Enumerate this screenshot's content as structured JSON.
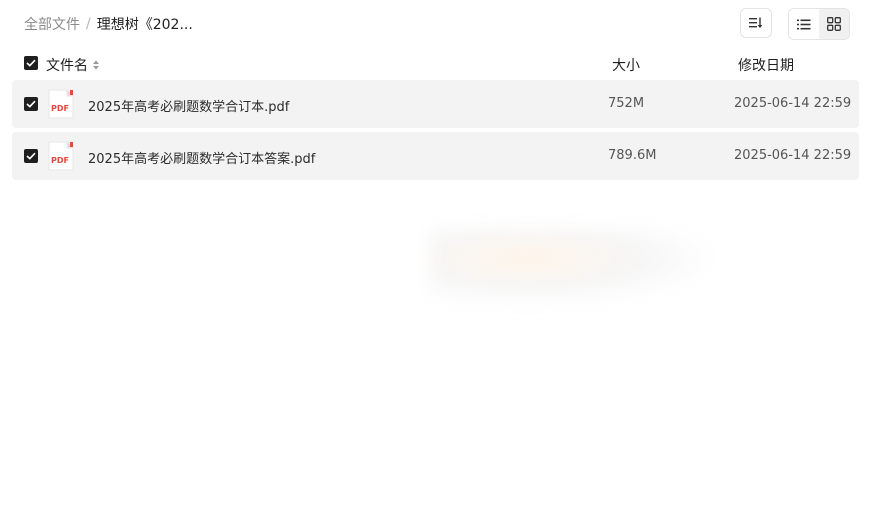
{
  "breadcrumb": {
    "root": "全部文件",
    "separator": "/",
    "current": "理想树《202..."
  },
  "toolbar": {
    "sort_icon": "sort-icon",
    "view_list_icon": "list-view-icon",
    "view_grid_icon": "grid-view-icon"
  },
  "columns": {
    "name": "文件名",
    "size": "大小",
    "date": "修改日期"
  },
  "files": [
    {
      "name": "2025年高考必刷题数学合订本.pdf",
      "size": "752M",
      "date": "2025-06-14 22:59",
      "type_label": "PDF",
      "checked": true
    },
    {
      "name": "2025年高考必刷题数学合订本答案.pdf",
      "size": "789.6M",
      "date": "2025-06-14 22:59",
      "type_label": "PDF",
      "checked": true
    }
  ],
  "colors": {
    "row_bg": "#f3f3f3",
    "checkbox": "#1f1f1f",
    "pdf_red": "#e04a3f"
  }
}
